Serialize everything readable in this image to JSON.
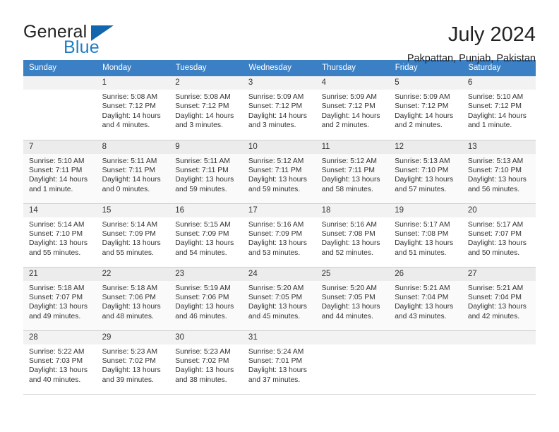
{
  "brand": {
    "name_part1": "General",
    "name_part2": "Blue",
    "triangle_color": "#1266ae",
    "blue_color": "#1f7dc4"
  },
  "header": {
    "title": "July 2024",
    "location": "Pakpattan, Punjab, Pakistan"
  },
  "calendar": {
    "header_bg": "#3b7fc4",
    "weekdays": [
      "Sunday",
      "Monday",
      "Tuesday",
      "Wednesday",
      "Thursday",
      "Friday",
      "Saturday"
    ],
    "weeks": [
      [
        {
          "day": "",
          "lines": []
        },
        {
          "day": "1",
          "lines": [
            "Sunrise: 5:08 AM",
            "Sunset: 7:12 PM",
            "Daylight: 14 hours",
            "and 4 minutes."
          ]
        },
        {
          "day": "2",
          "lines": [
            "Sunrise: 5:08 AM",
            "Sunset: 7:12 PM",
            "Daylight: 14 hours",
            "and 3 minutes."
          ]
        },
        {
          "day": "3",
          "lines": [
            "Sunrise: 5:09 AM",
            "Sunset: 7:12 PM",
            "Daylight: 14 hours",
            "and 3 minutes."
          ]
        },
        {
          "day": "4",
          "lines": [
            "Sunrise: 5:09 AM",
            "Sunset: 7:12 PM",
            "Daylight: 14 hours",
            "and 2 minutes."
          ]
        },
        {
          "day": "5",
          "lines": [
            "Sunrise: 5:09 AM",
            "Sunset: 7:12 PM",
            "Daylight: 14 hours",
            "and 2 minutes."
          ]
        },
        {
          "day": "6",
          "lines": [
            "Sunrise: 5:10 AM",
            "Sunset: 7:12 PM",
            "Daylight: 14 hours",
            "and 1 minute."
          ]
        }
      ],
      [
        {
          "day": "7",
          "lines": [
            "Sunrise: 5:10 AM",
            "Sunset: 7:11 PM",
            "Daylight: 14 hours",
            "and 1 minute."
          ]
        },
        {
          "day": "8",
          "lines": [
            "Sunrise: 5:11 AM",
            "Sunset: 7:11 PM",
            "Daylight: 14 hours",
            "and 0 minutes."
          ]
        },
        {
          "day": "9",
          "lines": [
            "Sunrise: 5:11 AM",
            "Sunset: 7:11 PM",
            "Daylight: 13 hours",
            "and 59 minutes."
          ]
        },
        {
          "day": "10",
          "lines": [
            "Sunrise: 5:12 AM",
            "Sunset: 7:11 PM",
            "Daylight: 13 hours",
            "and 59 minutes."
          ]
        },
        {
          "day": "11",
          "lines": [
            "Sunrise: 5:12 AM",
            "Sunset: 7:11 PM",
            "Daylight: 13 hours",
            "and 58 minutes."
          ]
        },
        {
          "day": "12",
          "lines": [
            "Sunrise: 5:13 AM",
            "Sunset: 7:10 PM",
            "Daylight: 13 hours",
            "and 57 minutes."
          ]
        },
        {
          "day": "13",
          "lines": [
            "Sunrise: 5:13 AM",
            "Sunset: 7:10 PM",
            "Daylight: 13 hours",
            "and 56 minutes."
          ]
        }
      ],
      [
        {
          "day": "14",
          "lines": [
            "Sunrise: 5:14 AM",
            "Sunset: 7:10 PM",
            "Daylight: 13 hours",
            "and 55 minutes."
          ]
        },
        {
          "day": "15",
          "lines": [
            "Sunrise: 5:14 AM",
            "Sunset: 7:09 PM",
            "Daylight: 13 hours",
            "and 55 minutes."
          ]
        },
        {
          "day": "16",
          "lines": [
            "Sunrise: 5:15 AM",
            "Sunset: 7:09 PM",
            "Daylight: 13 hours",
            "and 54 minutes."
          ]
        },
        {
          "day": "17",
          "lines": [
            "Sunrise: 5:16 AM",
            "Sunset: 7:09 PM",
            "Daylight: 13 hours",
            "and 53 minutes."
          ]
        },
        {
          "day": "18",
          "lines": [
            "Sunrise: 5:16 AM",
            "Sunset: 7:08 PM",
            "Daylight: 13 hours",
            "and 52 minutes."
          ]
        },
        {
          "day": "19",
          "lines": [
            "Sunrise: 5:17 AM",
            "Sunset: 7:08 PM",
            "Daylight: 13 hours",
            "and 51 minutes."
          ]
        },
        {
          "day": "20",
          "lines": [
            "Sunrise: 5:17 AM",
            "Sunset: 7:07 PM",
            "Daylight: 13 hours",
            "and 50 minutes."
          ]
        }
      ],
      [
        {
          "day": "21",
          "lines": [
            "Sunrise: 5:18 AM",
            "Sunset: 7:07 PM",
            "Daylight: 13 hours",
            "and 49 minutes."
          ]
        },
        {
          "day": "22",
          "lines": [
            "Sunrise: 5:18 AM",
            "Sunset: 7:06 PM",
            "Daylight: 13 hours",
            "and 48 minutes."
          ]
        },
        {
          "day": "23",
          "lines": [
            "Sunrise: 5:19 AM",
            "Sunset: 7:06 PM",
            "Daylight: 13 hours",
            "and 46 minutes."
          ]
        },
        {
          "day": "24",
          "lines": [
            "Sunrise: 5:20 AM",
            "Sunset: 7:05 PM",
            "Daylight: 13 hours",
            "and 45 minutes."
          ]
        },
        {
          "day": "25",
          "lines": [
            "Sunrise: 5:20 AM",
            "Sunset: 7:05 PM",
            "Daylight: 13 hours",
            "and 44 minutes."
          ]
        },
        {
          "day": "26",
          "lines": [
            "Sunrise: 5:21 AM",
            "Sunset: 7:04 PM",
            "Daylight: 13 hours",
            "and 43 minutes."
          ]
        },
        {
          "day": "27",
          "lines": [
            "Sunrise: 5:21 AM",
            "Sunset: 7:04 PM",
            "Daylight: 13 hours",
            "and 42 minutes."
          ]
        }
      ],
      [
        {
          "day": "28",
          "lines": [
            "Sunrise: 5:22 AM",
            "Sunset: 7:03 PM",
            "Daylight: 13 hours",
            "and 40 minutes."
          ]
        },
        {
          "day": "29",
          "lines": [
            "Sunrise: 5:23 AM",
            "Sunset: 7:02 PM",
            "Daylight: 13 hours",
            "and 39 minutes."
          ]
        },
        {
          "day": "30",
          "lines": [
            "Sunrise: 5:23 AM",
            "Sunset: 7:02 PM",
            "Daylight: 13 hours",
            "and 38 minutes."
          ]
        },
        {
          "day": "31",
          "lines": [
            "Sunrise: 5:24 AM",
            "Sunset: 7:01 PM",
            "Daylight: 13 hours",
            "and 37 minutes."
          ]
        },
        {
          "day": "",
          "lines": []
        },
        {
          "day": "",
          "lines": []
        },
        {
          "day": "",
          "lines": []
        }
      ]
    ]
  }
}
